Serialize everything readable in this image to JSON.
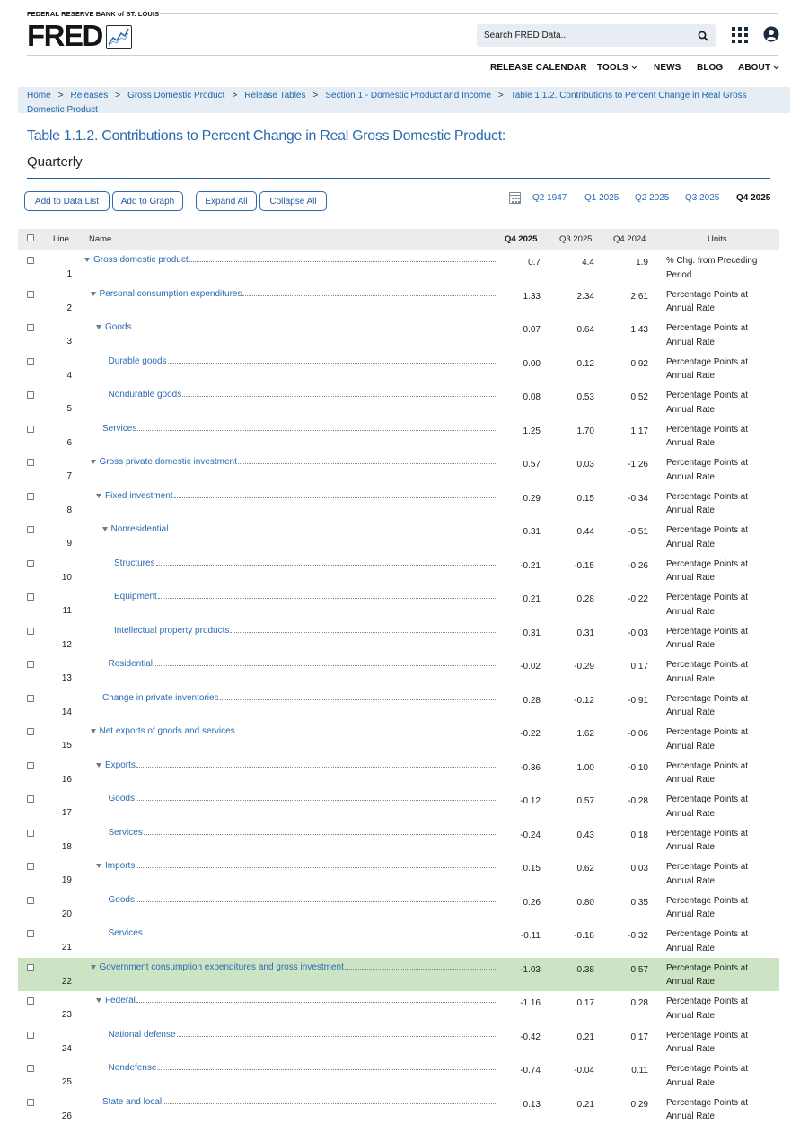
{
  "header": {
    "org_label": "FEDERAL RESERVE BANK of ST. LOUIS",
    "logo_text": "FRED",
    "search_placeholder": "Search FRED Data...",
    "nav": [
      {
        "label": "RELEASE CALENDAR",
        "has_dropdown": false
      },
      {
        "label": "TOOLS",
        "has_dropdown": true
      },
      {
        "label": "NEWS",
        "has_dropdown": false
      },
      {
        "label": "BLOG",
        "has_dropdown": false
      },
      {
        "label": "ABOUT",
        "has_dropdown": true
      }
    ]
  },
  "breadcrumb": [
    "Home",
    "Releases",
    "Gross Domestic Product",
    "Release Tables",
    "Section 1 - Domestic Product and Income",
    "Table 1.1.2. Contributions to Percent Change in Real Gross Domestic Product"
  ],
  "page": {
    "title": "Table 1.1.2. Contributions to Percent Change in Real Gross Domestic Product:",
    "subtitle": "Quarterly"
  },
  "toolbar": {
    "add_to_data_list": "Add to Data List",
    "add_to_graph": "Add to Graph",
    "expand_all": "Expand All",
    "collapse_all": "Collapse All",
    "periods": [
      "Q2 1947",
      "Q1 2025",
      "Q2 2025",
      "Q3 2025",
      "Q4 2025"
    ],
    "active_period": "Q4 2025"
  },
  "table": {
    "columns": {
      "line": "Line",
      "name": "Name",
      "c1": "Q4 2025",
      "c2": "Q3 2025",
      "c3": "Q4 2024",
      "units": "Units"
    },
    "rows": [
      {
        "line": "1",
        "name": "Gross domestic product",
        "level": 0,
        "expandable": true,
        "v1": "0.7",
        "v2": "4.4",
        "v3": "1.9",
        "units": "% Chg. from Preceding Period",
        "highlight": false
      },
      {
        "line": "2",
        "name": "Personal consumption expenditures",
        "level": 1,
        "expandable": true,
        "v1": "1.33",
        "v2": "2.34",
        "v3": "2.61",
        "units": "Percentage Points at Annual Rate",
        "highlight": false
      },
      {
        "line": "3",
        "name": "Goods",
        "level": 2,
        "expandable": true,
        "v1": "0.07",
        "v2": "0.64",
        "v3": "1.43",
        "units": "Percentage Points at Annual Rate",
        "highlight": false
      },
      {
        "line": "4",
        "name": "Durable goods",
        "level": 3,
        "expandable": false,
        "v1": "0.00",
        "v2": "0.12",
        "v3": "0.92",
        "units": "Percentage Points at Annual Rate",
        "highlight": false
      },
      {
        "line": "5",
        "name": "Nondurable goods",
        "level": 3,
        "expandable": false,
        "v1": "0.08",
        "v2": "0.53",
        "v3": "0.52",
        "units": "Percentage Points at Annual Rate",
        "highlight": false
      },
      {
        "line": "6",
        "name": "Services",
        "level": 2,
        "expandable": false,
        "v1": "1.25",
        "v2": "1.70",
        "v3": "1.17",
        "units": "Percentage Points at Annual Rate",
        "highlight": false
      },
      {
        "line": "7",
        "name": "Gross private domestic investment",
        "level": 1,
        "expandable": true,
        "v1": "0.57",
        "v2": "0.03",
        "v3": "-1.26",
        "units": "Percentage Points at Annual Rate",
        "highlight": false
      },
      {
        "line": "8",
        "name": "Fixed investment",
        "level": 2,
        "expandable": true,
        "v1": "0.29",
        "v2": "0.15",
        "v3": "-0.34",
        "units": "Percentage Points at Annual Rate",
        "highlight": false
      },
      {
        "line": "9",
        "name": "Nonresidential",
        "level": 3,
        "expandable": true,
        "v1": "0.31",
        "v2": "0.44",
        "v3": "-0.51",
        "units": "Percentage Points at Annual Rate",
        "highlight": false
      },
      {
        "line": "10",
        "name": "Structures",
        "level": 4,
        "expandable": false,
        "v1": "-0.21",
        "v2": "-0.15",
        "v3": "-0.26",
        "units": "Percentage Points at Annual Rate",
        "highlight": false
      },
      {
        "line": "11",
        "name": "Equipment",
        "level": 4,
        "expandable": false,
        "v1": "0.21",
        "v2": "0.28",
        "v3": "-0.22",
        "units": "Percentage Points at Annual Rate",
        "highlight": false
      },
      {
        "line": "12",
        "name": "Intellectual property products",
        "level": 4,
        "expandable": false,
        "v1": "0.31",
        "v2": "0.31",
        "v3": "-0.03",
        "units": "Percentage Points at Annual Rate",
        "highlight": false
      },
      {
        "line": "13",
        "name": "Residential",
        "level": 3,
        "expandable": false,
        "v1": "-0.02",
        "v2": "-0.29",
        "v3": "0.17",
        "units": "Percentage Points at Annual Rate",
        "highlight": false
      },
      {
        "line": "14",
        "name": "Change in private inventories",
        "level": 2,
        "expandable": false,
        "v1": "0.28",
        "v2": "-0.12",
        "v3": "-0.91",
        "units": "Percentage Points at Annual Rate",
        "highlight": false
      },
      {
        "line": "15",
        "name": "Net exports of goods and services",
        "level": 1,
        "expandable": true,
        "v1": "-0.22",
        "v2": "1.62",
        "v3": "-0.06",
        "units": "Percentage Points at Annual Rate",
        "highlight": false
      },
      {
        "line": "16",
        "name": "Exports",
        "level": 2,
        "expandable": true,
        "v1": "-0.36",
        "v2": "1.00",
        "v3": "-0.10",
        "units": "Percentage Points at Annual Rate",
        "highlight": false
      },
      {
        "line": "17",
        "name": "Goods",
        "level": 3,
        "expandable": false,
        "v1": "-0.12",
        "v2": "0.57",
        "v3": "-0.28",
        "units": "Percentage Points at Annual Rate",
        "highlight": false
      },
      {
        "line": "18",
        "name": "Services",
        "level": 3,
        "expandable": false,
        "v1": "-0.24",
        "v2": "0.43",
        "v3": "0.18",
        "units": "Percentage Points at Annual Rate",
        "highlight": false
      },
      {
        "line": "19",
        "name": "Imports",
        "level": 2,
        "expandable": true,
        "v1": "0.15",
        "v2": "0.62",
        "v3": "0.03",
        "units": "Percentage Points at Annual Rate",
        "highlight": false
      },
      {
        "line": "20",
        "name": "Goods",
        "level": 3,
        "expandable": false,
        "v1": "0.26",
        "v2": "0.80",
        "v3": "0.35",
        "units": "Percentage Points at Annual Rate",
        "highlight": false
      },
      {
        "line": "21",
        "name": "Services",
        "level": 3,
        "expandable": false,
        "v1": "-0.11",
        "v2": "-0.18",
        "v3": "-0.32",
        "units": "Percentage Points at Annual Rate",
        "highlight": false
      },
      {
        "line": "22",
        "name": "Government consumption expenditures and gross investment",
        "level": 1,
        "expandable": true,
        "v1": "-1.03",
        "v2": "0.38",
        "v3": "0.57",
        "units": "Percentage Points at Annual Rate",
        "highlight": true
      },
      {
        "line": "23",
        "name": "Federal",
        "level": 2,
        "expandable": true,
        "v1": "-1.16",
        "v2": "0.17",
        "v3": "0.28",
        "units": "Percentage Points at Annual Rate",
        "highlight": false
      },
      {
        "line": "24",
        "name": "National defense",
        "level": 3,
        "expandable": false,
        "v1": "-0.42",
        "v2": "0.21",
        "v3": "0.17",
        "units": "Percentage Points at Annual Rate",
        "highlight": false
      },
      {
        "line": "25",
        "name": "Nondefense",
        "level": 3,
        "expandable": false,
        "v1": "-0.74",
        "v2": "-0.04",
        "v3": "0.11",
        "units": "Percentage Points at Annual Rate",
        "highlight": false
      },
      {
        "line": "26",
        "name": "State and local",
        "level": 2,
        "expandable": false,
        "v1": "0.13",
        "v2": "0.21",
        "v3": "0.29",
        "units": "Percentage Points at Annual Rate",
        "highlight": false
      }
    ]
  },
  "colors": {
    "link": "#2a6bb0",
    "highlight_row": "#cce3c4",
    "breadcrumb_bg": "#e6edf5",
    "header_bg": "#ececec"
  }
}
